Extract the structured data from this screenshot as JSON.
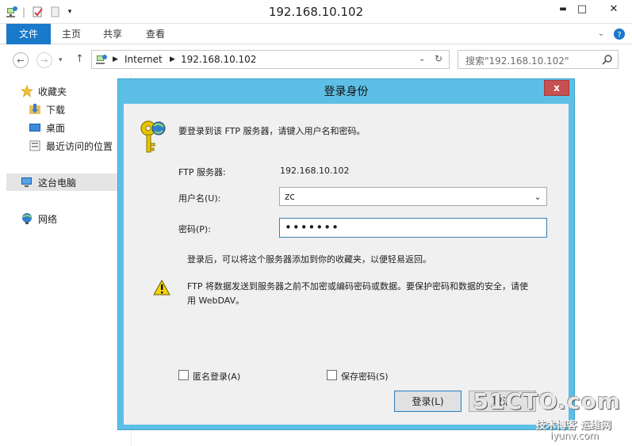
{
  "window": {
    "title": "192.168.10.102",
    "minimize": "▬",
    "maximize": "□",
    "close": "✕"
  },
  "ribbon": {
    "tabs": [
      "文件",
      "主页",
      "共享",
      "查看"
    ]
  },
  "address": {
    "crumbs": [
      "Internet",
      "192.168.10.102"
    ],
    "search_placeholder": "搜索\"192.168.10.102\""
  },
  "nav": {
    "favorites": "收藏夹",
    "downloads": "下载",
    "desktop": "桌面",
    "recent": "最近访问的位置",
    "this_pc": "这台电脑",
    "network": "网络"
  },
  "dialog": {
    "title": "登录身份",
    "close": "x",
    "intro": "要登录到该 FTP 服务器，请键入用户名和密码。",
    "server_label": "FTP 服务器:",
    "server_value": "192.168.10.102",
    "username_label": "用户名(U):",
    "username_value": "zc",
    "password_label": "密码(P):",
    "password_value": "•••••••",
    "favorites_note": "登录后，可以将这个服务器添加到你的收藏夹，以便轻易返回。",
    "warning_line1": "FTP 将数据发送到服务器之前不加密或编码密码或数据。要保护密码和数据的安全，请使",
    "warning_line2": "用 WebDAV。",
    "anonymous_label": "匿名登录(A)",
    "save_password_label": "保存密码(S)",
    "login_button": "登录(L)",
    "cancel_button": "取消"
  },
  "watermark": {
    "main": "51CTO.com",
    "sub": "技术博客 运维网",
    "site": "iyunv.com"
  }
}
